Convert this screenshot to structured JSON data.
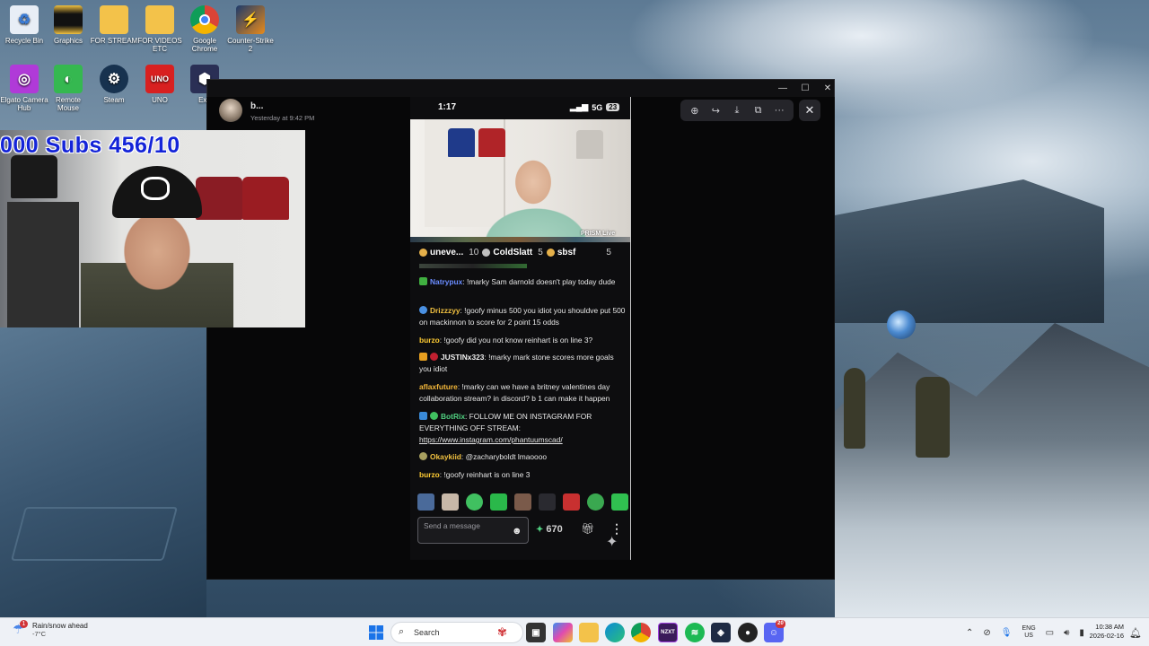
{
  "desktop": {
    "icons": [
      {
        "label": "Recycle Bin",
        "icon": "recycle-bin-icon"
      },
      {
        "label": "Graphics",
        "icon": "folder-icon"
      },
      {
        "label": "FOR STREAM",
        "icon": "folder-icon"
      },
      {
        "label": "FOR VIDEOS ETC",
        "icon": "folder-icon"
      },
      {
        "label": "Google Chrome",
        "icon": "chrome-icon"
      },
      {
        "label": "Counter-Strike 2",
        "icon": "counter-strike-icon"
      },
      {
        "label": "Elgato Camera Hub",
        "icon": "elgato-icon"
      },
      {
        "label": "Remote Mouse",
        "icon": "remote-mouse-icon"
      },
      {
        "label": "Steam",
        "icon": "steam-icon"
      },
      {
        "label": "UNO",
        "icon": "uno-icon"
      },
      {
        "label": "Exo",
        "icon": "exo-icon"
      }
    ]
  },
  "stream_overlay": {
    "sub_goal": "000 Subs  456/10"
  },
  "image_viewer": {
    "author_name": "b...",
    "timestamp": "Yesterday at 9:42 PM",
    "toolbar": {
      "zoom": "zoom-in-icon",
      "forward": "share-forward-icon",
      "download": "download-icon",
      "open": "open-external-icon",
      "more": "···",
      "close": "✕"
    }
  },
  "phone": {
    "status": {
      "time": "1:17",
      "network": "5G",
      "battery": "23"
    },
    "watermark": "PRISM Live",
    "leaderboard": [
      {
        "name": "uneve...",
        "count": "10"
      },
      {
        "name": "ColdSlatt",
        "count": "5"
      },
      {
        "name": "sbsf",
        "count": "5"
      }
    ],
    "chat": [
      {
        "user": "Natrypux",
        "color": "#6a8cff",
        "text": ": !marky Sam darnold doesn't play today dude"
      },
      {
        "user": "Drizzzyy",
        "color": "#f0c040",
        "text": ": !goofy minus 500 you idiot you shouldve put 500 on mackinnon to score for 2 point 15 odds"
      },
      {
        "user": "burzo",
        "color": "#ffcc33",
        "text": ": !goofy did you not know reinhart is on line 3?"
      },
      {
        "user": "JUSTINx323",
        "color": "#f0f0f0",
        "text": ": !marky mark stone scores more goals you idiot"
      },
      {
        "user": "aflaxfuture",
        "color": "#f5b83a",
        "text": ": !marky can we have a britney valentines day collaboration stream? in discord? b 1 can make it happen"
      },
      {
        "user": "BotRix",
        "color": "#50d080",
        "text": ": FOLLOW ME ON INSTAGRAM FOR EVERYTHING OFF STREAM:",
        "link": "https://www.instagram.com/phantuumscad/"
      },
      {
        "user": "Okaykiid",
        "color": "#f0c040",
        "text": ": @zacharyboldt lmaoooo"
      },
      {
        "user": "burzo",
        "color": "#ffcc33",
        "text": ": !goofy reinhart is on line 3"
      }
    ],
    "input_placeholder": "Send a message",
    "points": "670"
  },
  "taskbar": {
    "weather_title": "Rain/snow ahead",
    "weather_temp": "-7°C",
    "weather_badge": "1",
    "search_label": "Search",
    "apps": [
      "start-icon",
      "search-icon",
      "task-view-icon",
      "copilot-icon",
      "file-explorer-icon",
      "edge-icon",
      "chrome-icon",
      "nzxt-icon",
      "spotify-icon",
      "app-icon",
      "obs-icon",
      "discord-icon"
    ],
    "nzxt_label": "NZXT",
    "discord_badge": "20",
    "lang_top": "ENG",
    "lang_bottom": "US",
    "time": "10:38 AM",
    "date": "2026-02-16"
  }
}
